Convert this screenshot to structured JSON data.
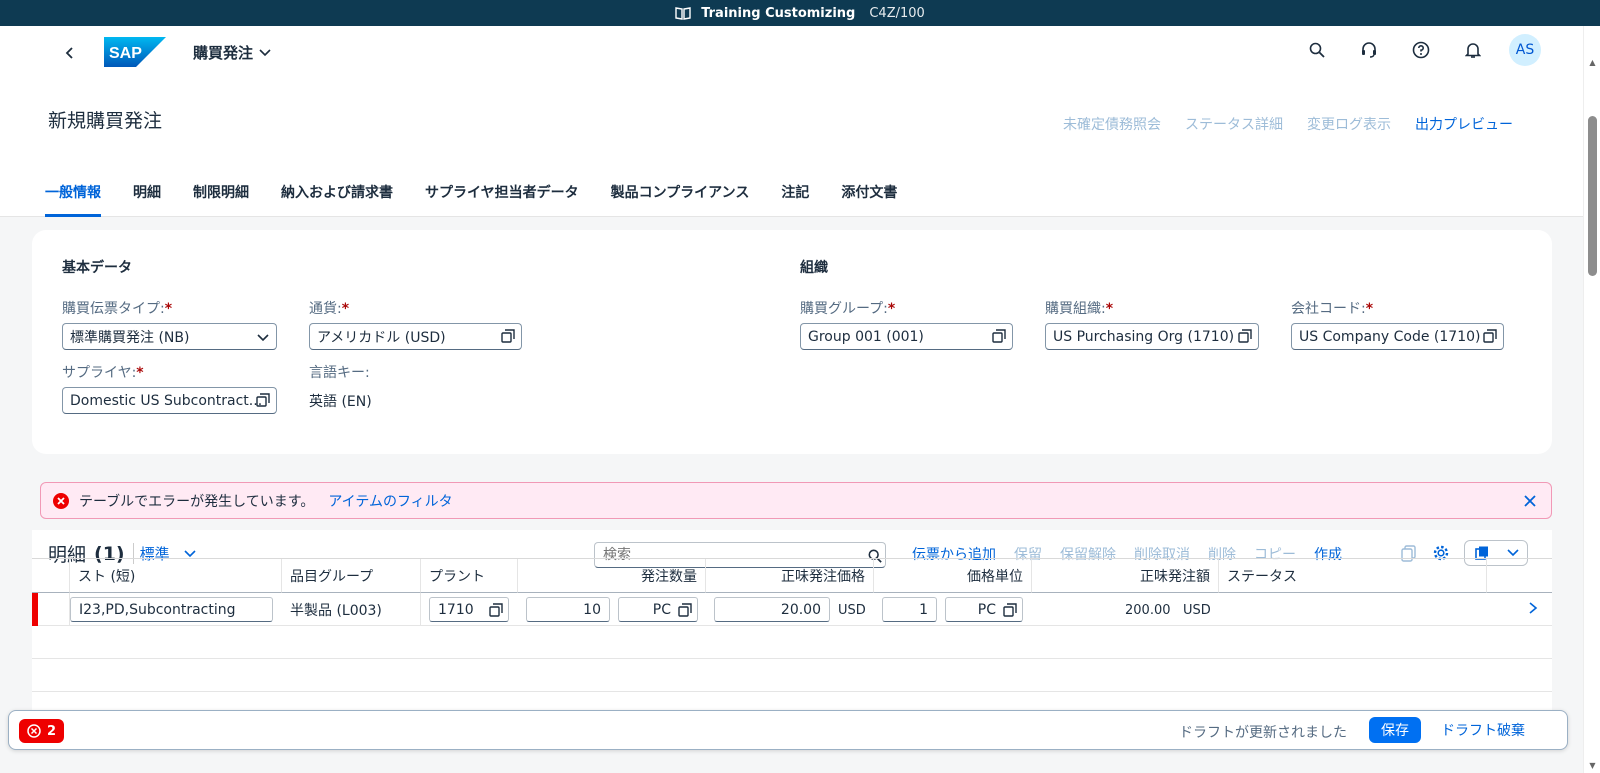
{
  "system_bar": {
    "title": "Training Customizing",
    "client": "C4Z/100"
  },
  "shell": {
    "app_title": "購買発注",
    "avatar_initials": "AS"
  },
  "object": {
    "title": "新規購買発注",
    "actions": [
      "未確定債務照会",
      "ステータス詳細",
      "変更ログ表示",
      "出力プレビュー"
    ]
  },
  "tabs": [
    "一般情報",
    "明細",
    "制限明細",
    "納入および請求書",
    "サプライヤ担当者データ",
    "製品コンプライアンス",
    "注記",
    "添付文書"
  ],
  "basic_data": {
    "title": "基本データ",
    "doc_type_label": "購買伝票タイプ:",
    "doc_type_value": "標準購買発注 (NB)",
    "currency_label": "通貨:",
    "currency_value": "アメリカドル (USD)",
    "supplier_label": "サプライヤ:",
    "supplier_value": "Domestic US Subcontract...",
    "language_label": "言語キー:",
    "language_value": "英語 (EN)"
  },
  "organization": {
    "title": "組織",
    "purch_group_label": "購買グループ:",
    "purch_group_value": "Group 001 (001)",
    "purch_org_label": "購買組織:",
    "purch_org_value": "US Purchasing Org (1710)",
    "company_label": "会社コード:",
    "company_value": "US Company Code (1710)"
  },
  "error_strip": {
    "message": "テーブルでエラーが発生しています。",
    "link": "アイテムのフィルタ"
  },
  "items": {
    "title": "明細",
    "count": "(1)",
    "variant": "標準",
    "search_placeholder": "検索",
    "actions": [
      {
        "label": "伝票から追加",
        "enabled": true
      },
      {
        "label": "保留",
        "enabled": false
      },
      {
        "label": "保留解除",
        "enabled": false
      },
      {
        "label": "削除取消",
        "enabled": false
      },
      {
        "label": "削除",
        "enabled": false
      },
      {
        "label": "コピー",
        "enabled": false
      },
      {
        "label": "作成",
        "enabled": true
      }
    ],
    "columns": {
      "short_text": "スト (短)",
      "material_group": "品目グループ",
      "plant": "プラント",
      "order_qty": "発注数量",
      "net_price": "正味発注価格",
      "price_unit": "価格単位",
      "net_value": "正味発注額",
      "status": "ステータス"
    },
    "row": {
      "short_text": "I23,PD,Subcontracting",
      "material_group": "半製品 (L003)",
      "plant": "1710",
      "qty": "10",
      "qty_unit": "PC",
      "net_price": "20.00",
      "price_currency": "USD",
      "price_unit": "1",
      "price_unit_uom": "PC",
      "net_value": "200.00",
      "value_currency": "USD"
    }
  },
  "footer": {
    "error_count": "2",
    "draft_message": "ドラフトが更新されました",
    "save_label": "保存",
    "discard_label": "ドラフト破棄"
  },
  "colors": {
    "accent": "#0064d9",
    "shell_bar": "#0e3a52",
    "error": "#e00000"
  }
}
